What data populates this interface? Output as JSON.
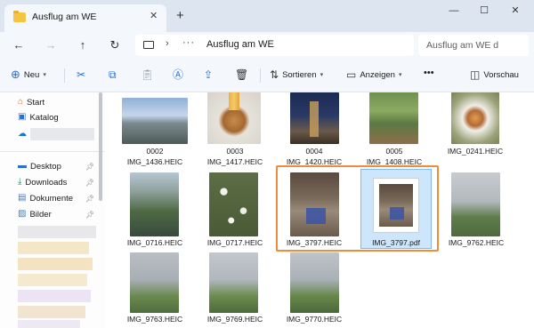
{
  "window": {
    "tab_title": "Ausflug am WE",
    "new_tab": "+",
    "close_tab": "✕",
    "minimize": "—",
    "maximize": "☐",
    "close": "✕"
  },
  "nav": {
    "back": "←",
    "forward": "→",
    "up": "↑",
    "refresh": "↻",
    "chevron": "›",
    "more": "···",
    "path": "Ausflug am WE",
    "search_placeholder": "Ausflug am WE d"
  },
  "commands": {
    "new_label": "Neu",
    "sort_label": "Sortieren",
    "view_label": "Anzeigen",
    "more": "•••",
    "preview_label": "Vorschau"
  },
  "sidebar": {
    "items": [
      {
        "label": "Start",
        "icon": "home-icon"
      },
      {
        "label": "Katalog",
        "icon": "gallery-icon"
      },
      {
        "label": "",
        "icon": "onedrive-icon"
      },
      {
        "label": "Desktop",
        "icon": "desktop-icon"
      },
      {
        "label": "Downloads",
        "icon": "download-icon"
      },
      {
        "label": "Dokumente",
        "icon": "document-icon"
      },
      {
        "label": "Bilder",
        "icon": "pictures-icon"
      }
    ]
  },
  "files": [
    {
      "name1": "0002",
      "name2": "IMG_1436.HEIC"
    },
    {
      "name1": "0003",
      "name2": "IMG_1417.HEIC"
    },
    {
      "name1": "0004",
      "name2": "IMG_1420.HEIC"
    },
    {
      "name1": "0005",
      "name2": "IMG_1408.HEIC"
    },
    {
      "name1": "",
      "name2": "IMG_0241.HEIC"
    },
    {
      "name1": "",
      "name2": "IMG_0716.HEIC"
    },
    {
      "name1": "",
      "name2": "IMG_0717.HEIC"
    },
    {
      "name1": "",
      "name2": "IMG_3797.HEIC"
    },
    {
      "name1": "",
      "name2": "IMG_3797.pdf"
    },
    {
      "name1": "",
      "name2": "IMG_9762.HEIC"
    },
    {
      "name1": "",
      "name2": "IMG_9763.HEIC"
    },
    {
      "name1": "",
      "name2": "IMG_9769.HEIC"
    },
    {
      "name1": "",
      "name2": "IMG_9770.HEIC"
    }
  ],
  "colors": {
    "accent": "#2a6fd6",
    "highlight": "#f08b3c",
    "selection": "#cde6fb"
  }
}
